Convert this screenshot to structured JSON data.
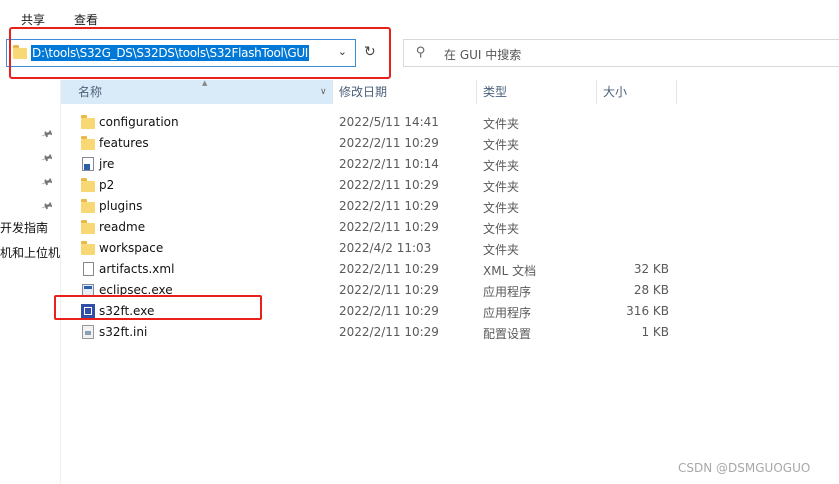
{
  "ribbon": {
    "tabs": [
      "共享",
      "查看"
    ]
  },
  "address_bar": {
    "path": "D:\\tools\\S32G_DS\\S32DS\\tools\\S32FlashTool\\GUI",
    "dropdown_icon": "chevron-down-icon",
    "refresh_icon": "refresh-icon"
  },
  "search": {
    "placeholder": "在 GUI 中搜索",
    "icon": "search-icon"
  },
  "sidebar": {
    "pins": [
      "pin-icon",
      "pin-icon",
      "pin-icon",
      "pin-icon"
    ],
    "items": [
      "开发指南",
      "机和上位机"
    ]
  },
  "columns": {
    "name": "名称",
    "date": "修改日期",
    "type": "类型",
    "size": "大小"
  },
  "files": [
    {
      "name": "configuration",
      "date": "2022/5/11 14:41",
      "type": "文件夹",
      "size": "",
      "icon": "folder-icon"
    },
    {
      "name": "features",
      "date": "2022/2/11 10:29",
      "type": "文件夹",
      "size": "",
      "icon": "folder-icon"
    },
    {
      "name": "jre",
      "date": "2022/2/11 10:14",
      "type": "文件夹",
      "size": "",
      "icon": "shortcut-folder-icon"
    },
    {
      "name": "p2",
      "date": "2022/2/11 10:29",
      "type": "文件夹",
      "size": "",
      "icon": "folder-icon"
    },
    {
      "name": "plugins",
      "date": "2022/2/11 10:29",
      "type": "文件夹",
      "size": "",
      "icon": "folder-icon"
    },
    {
      "name": "readme",
      "date": "2022/2/11 10:29",
      "type": "文件夹",
      "size": "",
      "icon": "folder-icon"
    },
    {
      "name": "workspace",
      "date": "2022/4/2 11:03",
      "type": "文件夹",
      "size": "",
      "icon": "folder-icon"
    },
    {
      "name": "artifacts.xml",
      "date": "2022/2/11 10:29",
      "type": "XML 文档",
      "size": "32 KB",
      "icon": "xml-file-icon"
    },
    {
      "name": "eclipsec.exe",
      "date": "2022/2/11 10:29",
      "type": "应用程序",
      "size": "28 KB",
      "icon": "exe-icon"
    },
    {
      "name": "s32ft.exe",
      "date": "2022/2/11 10:29",
      "type": "应用程序",
      "size": "316 KB",
      "icon": "s32ft-app-icon"
    },
    {
      "name": "s32ft.ini",
      "date": "2022/2/11 10:29",
      "type": "配置设置",
      "size": "1 KB",
      "icon": "ini-file-icon"
    }
  ],
  "highlight_color": "#e8221b",
  "selection_color": "#0078d7",
  "watermark": "CSDN @DSMGUOGUO"
}
